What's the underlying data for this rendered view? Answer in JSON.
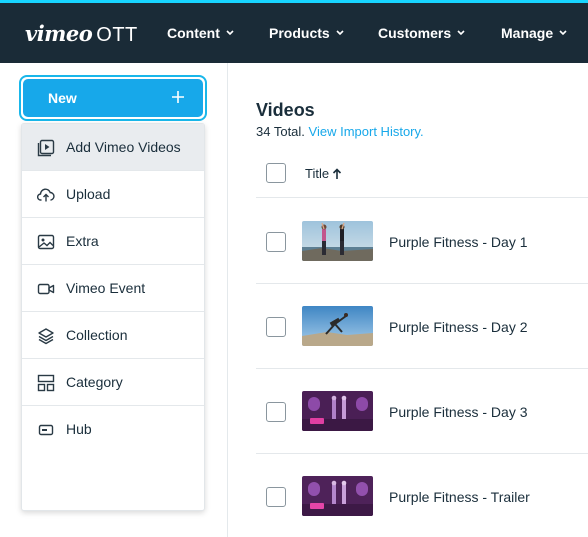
{
  "header": {
    "logo_word": "vimeo",
    "logo_suffix": "OTT",
    "nav": [
      {
        "label": "Content"
      },
      {
        "label": "Products"
      },
      {
        "label": "Customers"
      },
      {
        "label": "Manage"
      }
    ]
  },
  "sidebar": {
    "new_button_label": "New",
    "menu": [
      {
        "label": "Add Vimeo Videos",
        "icon": "add-video-icon"
      },
      {
        "label": "Upload",
        "icon": "cloud-upload-icon"
      },
      {
        "label": "Extra",
        "icon": "image-icon"
      },
      {
        "label": "Vimeo Event",
        "icon": "video-camera-icon"
      },
      {
        "label": "Collection",
        "icon": "layers-icon"
      },
      {
        "label": "Category",
        "icon": "category-grid-icon"
      },
      {
        "label": "Hub",
        "icon": "hub-icon"
      }
    ]
  },
  "main": {
    "title": "Videos",
    "total_text": "34 Total.",
    "import_link": "View Import History.",
    "column_title": "Title",
    "videos": [
      {
        "title": "Purple Fitness - Day 1"
      },
      {
        "title": "Purple Fitness - Day 2"
      },
      {
        "title": "Purple Fitness - Day 3"
      },
      {
        "title": "Purple Fitness - Trailer"
      }
    ]
  },
  "colors": {
    "topbar": "#1a2b37",
    "accent": "#17a8ea",
    "highlight": "#17d5ff"
  }
}
